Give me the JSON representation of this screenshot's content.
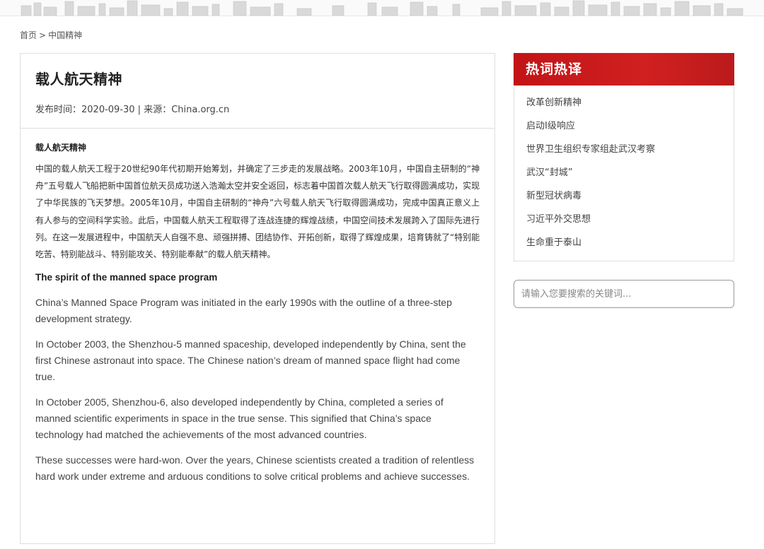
{
  "breadcrumb": {
    "home": "首页",
    "separator": ">",
    "current": "中国精神"
  },
  "article": {
    "title": "载人航天精神",
    "meta": "发布时间：2020-09-30 | 来源：China.org.cn",
    "cn_heading": "载人航天精神",
    "cn_paragraph": "中国的载人航天工程于20世纪90年代初期开始筹划，并确定了三步走的发展战略。2003年10月，中国自主研制的“神舟”五号载人飞船把新中国首位航天员成功送入浩瀚太空并安全返回，标志着中国首次载人航天飞行取得圆满成功，实现了中华民族的飞天梦想。2005年10月，中国自主研制的“神舟”六号载人航天飞行取得圆满成功，完成中国真正意义上有人参与的空间科学实验。此后，中国载人航天工程取得了连战连捷的辉煌战绩，中国空间技术发展跨入了国际先进行列。在这一发展进程中，中国航天人自强不息、顽强拼搏、团结协作、开拓创新，取得了辉煌成果，培育铸就了“特别能吃苦、特别能战斗、特别能攻关、特别能奉献”的载人航天精神。",
    "en_heading": "The spirit of the manned space program",
    "en_paragraphs": [
      "China’s Manned Space Program was initiated in the early 1990s with the outline of a three-step development strategy.",
      "In October 2003, the Shenzhou-5 manned spaceship, developed independently by China, sent the first Chinese astronaut into space. The Chinese nation’s dream of manned space flight had come true.",
      "In October 2005, Shenzhou-6, also developed independently by China, completed a series of manned scientific experiments in space in the true sense. This signified that China’s space technology had matched the achievements of the most advanced countries.",
      "These successes were hard-won. Over the years, Chinese scientists created a tradition of relentless hard work under extreme and arduous conditions to solve critical problems and achieve successes."
    ]
  },
  "sidebar": {
    "hot_title": "热词热译",
    "hot_items": [
      "改革创新精神",
      "启动Ⅰ级响应",
      "世界卫生组织专家组赴武汉考察",
      "武汉“封城”",
      "新型冠状病毒",
      "习近平外交思想",
      "生命重于泰山"
    ],
    "search_placeholder": "请输入您要搜索的关键词..."
  },
  "colors": {
    "accent_red": "#c21417",
    "border": "#dedede"
  }
}
